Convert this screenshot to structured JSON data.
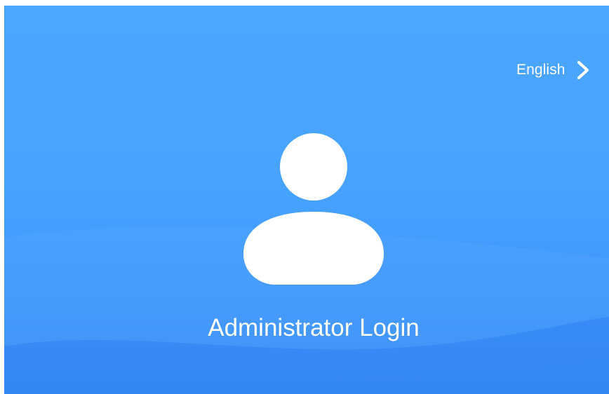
{
  "header": {
    "language_label": "English",
    "language_chevron_icon": "chevron-right-icon"
  },
  "main": {
    "avatar_icon": "user-icon",
    "title": "Administrator Login"
  },
  "colors": {
    "background_top": "#4ba6ff",
    "background_bottom": "#3a8ef6",
    "foreground": "#ffffff"
  }
}
